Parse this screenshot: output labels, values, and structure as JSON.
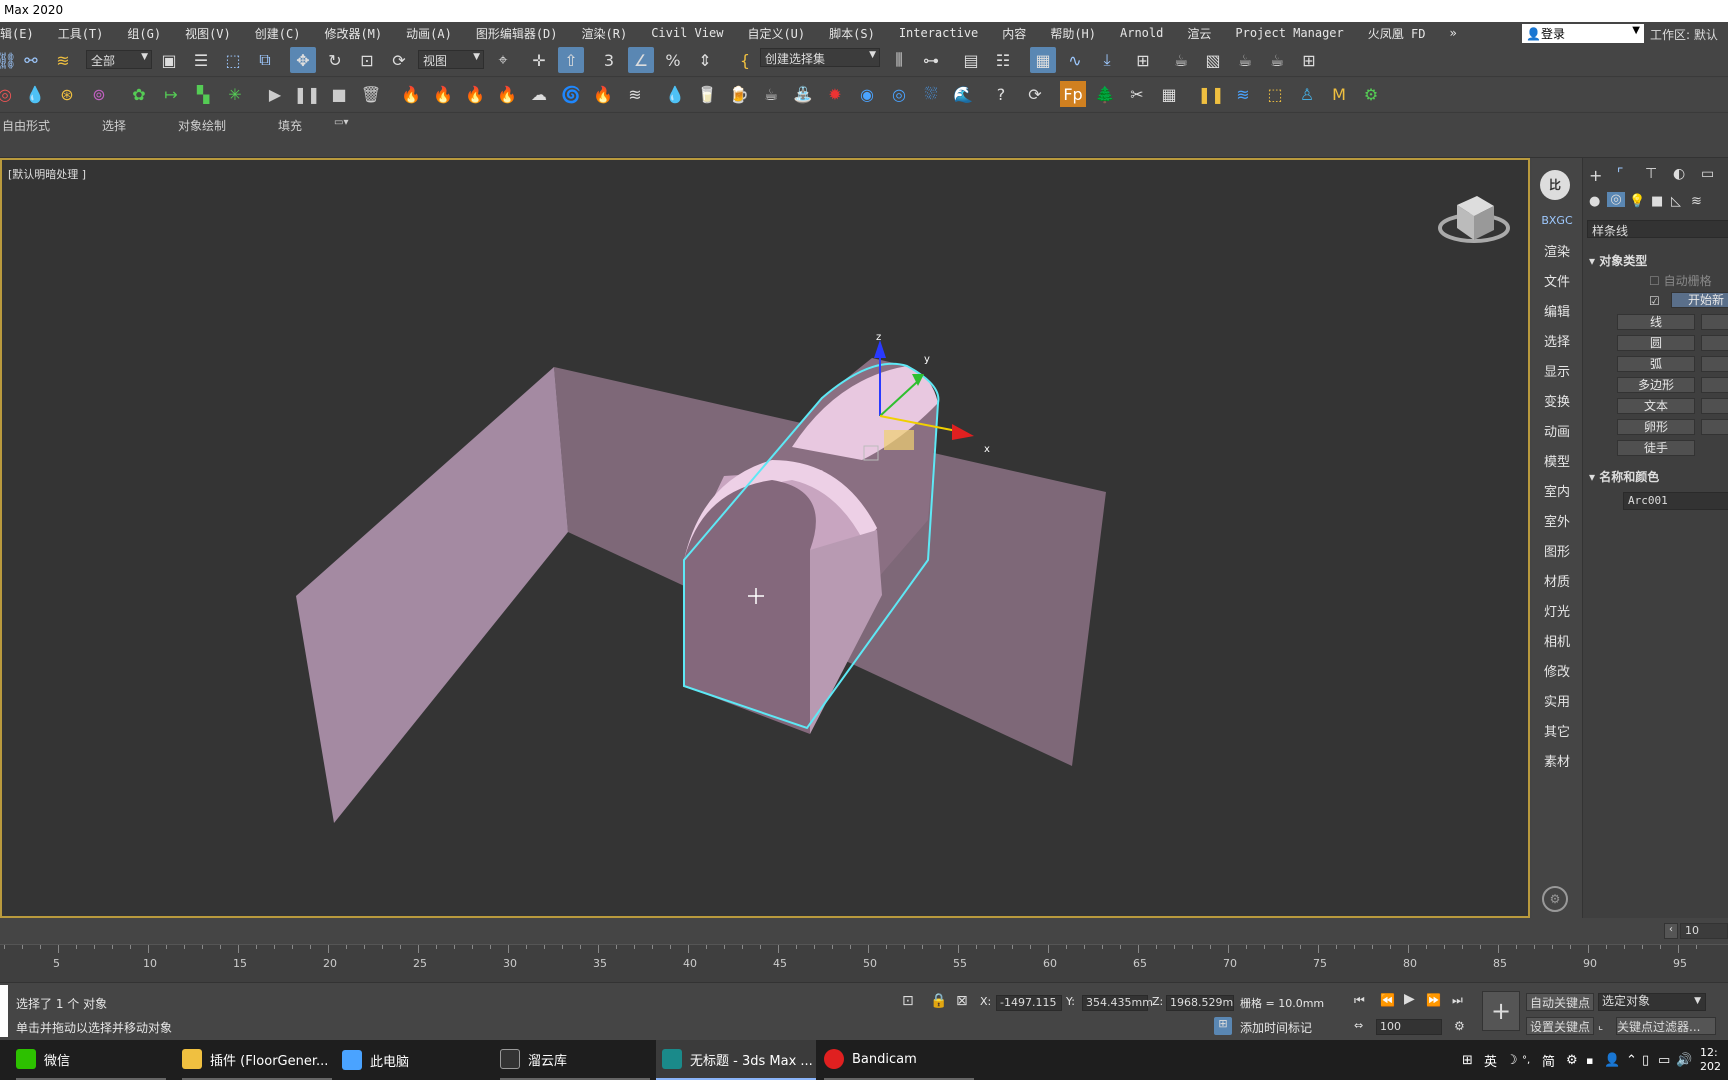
{
  "window": {
    "title": "Max 2020"
  },
  "menu": [
    "辑(E)",
    "工具(T)",
    "组(G)",
    "视图(V)",
    "创建(C)",
    "修改器(M)",
    "动画(A)",
    "图形编辑器(D)",
    "渲染(R)",
    "Civil View",
    "自定义(U)",
    "脚本(S)",
    "Interactive",
    "内容",
    "帮助(H)",
    "Arnold",
    "渲云",
    "Project Manager",
    "火凤凰 FD"
  ],
  "menu_overflow": "»",
  "login": "登录",
  "workspace": "工作区: 默认",
  "toolbar": {
    "filter_value": "全部",
    "refcoord_value": "视图",
    "selection_set_placeholder": "创建选择集"
  },
  "ribbon": {
    "tabs": [
      "自由形式",
      "选择",
      "对象绘制",
      "填充"
    ]
  },
  "viewport": {
    "label": "[默认明暗处理 ]"
  },
  "gizmo": {
    "x": "x",
    "y": "y",
    "z": "z"
  },
  "side_nav": {
    "top": "BXGC",
    "items": [
      "渲染",
      "文件",
      "编辑",
      "选择",
      "显示",
      "变换",
      "动画",
      "模型",
      "室内",
      "室外",
      "图形",
      "材质",
      "灯光",
      "相机",
      "修改",
      "实用",
      "其它",
      "素材"
    ]
  },
  "command_panel": {
    "category": "样条线",
    "object_type_title": "对象类型",
    "auto_grid": "自动栅格",
    "start_new_shape": "开始新",
    "buttons": [
      "线",
      "圆",
      "弧",
      "多边形",
      "文本",
      "卵形",
      "徒手"
    ],
    "name_color_title": "名称和颜色",
    "object_name": "Arc001"
  },
  "timeline": {
    "frame_field": "10",
    "ticks": [
      "5",
      "10",
      "15",
      "20",
      "25",
      "30",
      "35",
      "40",
      "45",
      "50",
      "55",
      "60",
      "65",
      "70",
      "75",
      "80",
      "85",
      "90",
      "95"
    ]
  },
  "status": {
    "selection": "选择了 1 个 对象",
    "prompt": "单击并拖动以选择并移动对象",
    "x_label": "X:",
    "x_value": "-1497.115",
    "y_label": "Y:",
    "y_value": "354.435mm",
    "z_label": "Z:",
    "z_value": "1968.529m",
    "grid": "栅格 = 10.0mm",
    "add_time_tag": "添加时间标记",
    "auto_key": "自动关键点",
    "set_key": "设置关键点",
    "selected_objects": "选定对象",
    "key_filters": "关键点过滤器...",
    "frame_count": "100"
  },
  "taskbar": {
    "apps": [
      "微信",
      "插件 (FloorGener...",
      "此电脑",
      "溜云库",
      "无标题 - 3ds Max ...",
      "Bandicam"
    ],
    "tray_lang": "英",
    "tray_ime": "简",
    "clock_time": "12:",
    "clock_date": "202"
  },
  "colors": {
    "accent_viewport_border": "#b99a3d",
    "selection_outline": "#5ee8f5",
    "object_pink": "#d9b8d2"
  }
}
